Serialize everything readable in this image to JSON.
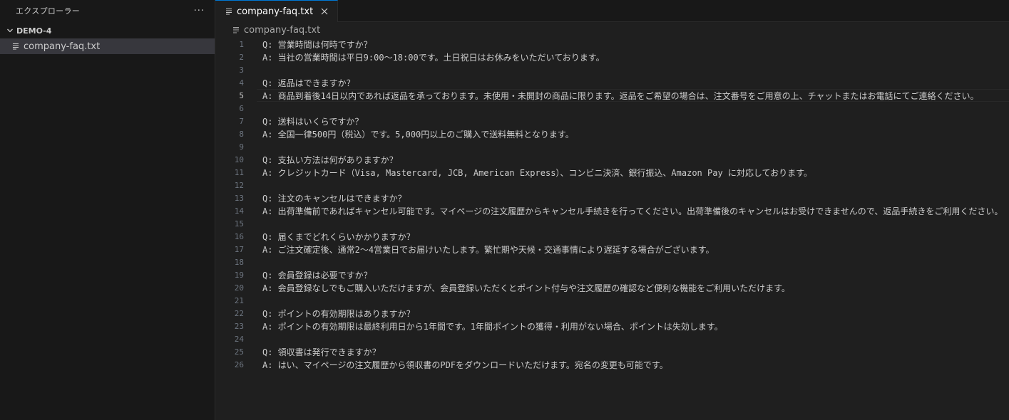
{
  "sidebar": {
    "title": "エクスプローラー",
    "more": "···",
    "folder": "DEMO-4",
    "file": "company-faq.txt"
  },
  "tab": {
    "label": "company-faq.txt"
  },
  "breadcrumb": "company-faq.txt",
  "current_line": 5,
  "lines": [
    {
      "n": "1",
      "text": "Q: 営業時間は何時ですか？"
    },
    {
      "n": "2",
      "text": "A: 当社の営業時間は平日9:00〜18:00です。土日祝日はお休みをいただいております。"
    },
    {
      "n": "3",
      "text": ""
    },
    {
      "n": "4",
      "text": "Q: 返品はできますか？"
    },
    {
      "n": "5",
      "text": "A: 商品到着後14日以内であれば返品を承っております。未使用・未開封の商品に限ります。返品をご希望の場合は、注文番号をご用意の上、チャットまたはお電話にてご連絡ください。"
    },
    {
      "n": "6",
      "text": ""
    },
    {
      "n": "7",
      "text": "Q: 送料はいくらですか？"
    },
    {
      "n": "8",
      "text": "A: 全国一律500円（税込）です。5,000円以上のご購入で送料無料となります。"
    },
    {
      "n": "9",
      "text": ""
    },
    {
      "n": "10",
      "text": "Q: 支払い方法は何がありますか？"
    },
    {
      "n": "11",
      "text": "A: クレジットカード（Visa, Mastercard, JCB, American Express）、コンビニ決済、銀行振込、Amazon Pay に対応しております。"
    },
    {
      "n": "12",
      "text": ""
    },
    {
      "n": "13",
      "text": "Q: 注文のキャンセルはできますか？"
    },
    {
      "n": "14",
      "text": "A: 出荷準備前であればキャンセル可能です。マイページの注文履歴からキャンセル手続きを行ってください。出荷準備後のキャンセルはお受けできませんので、返品手続きをご利用ください。"
    },
    {
      "n": "15",
      "text": ""
    },
    {
      "n": "16",
      "text": "Q: 届くまでどれくらいかかりますか？"
    },
    {
      "n": "17",
      "text": "A: ご注文確定後、通常2〜4営業日でお届けいたします。繁忙期や天候・交通事情により遅延する場合がございます。"
    },
    {
      "n": "18",
      "text": ""
    },
    {
      "n": "19",
      "text": "Q: 会員登録は必要ですか？"
    },
    {
      "n": "20",
      "text": "A: 会員登録なしでもご購入いただけますが、会員登録いただくとポイント付与や注文履歴の確認など便利な機能をご利用いただけます。"
    },
    {
      "n": "21",
      "text": ""
    },
    {
      "n": "22",
      "text": "Q: ポイントの有効期限はありますか？"
    },
    {
      "n": "23",
      "text": "A: ポイントの有効期限は最終利用日から1年間です。1年間ポイントの獲得・利用がない場合、ポイントは失効します。"
    },
    {
      "n": "24",
      "text": ""
    },
    {
      "n": "25",
      "text": "Q: 領収書は発行できますか？"
    },
    {
      "n": "26",
      "text": "A: はい、マイページの注文履歴から領収書のPDFをダウンロードいただけます。宛名の変更も可能です。"
    }
  ]
}
